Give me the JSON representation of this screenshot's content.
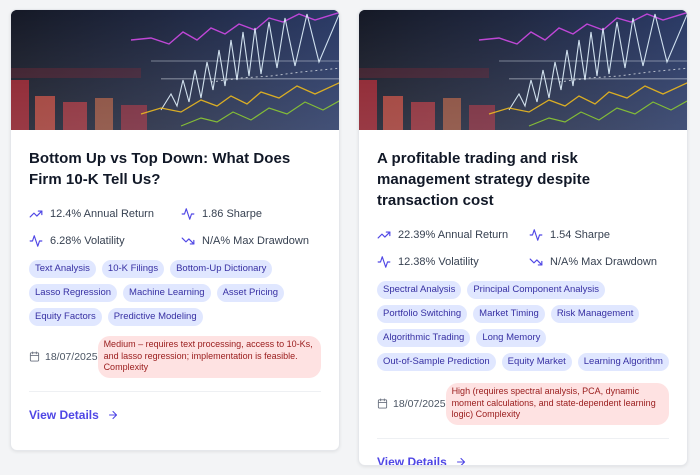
{
  "cards": [
    {
      "title": "Bottom Up vs Top Down: What Does Firm 10-K Tell Us?",
      "metrics": {
        "annual_return": "12.4% Annual Return",
        "sharpe": "1.86 Sharpe",
        "volatility": "6.28% Volatility",
        "max_drawdown": "N/A% Max Drawdown"
      },
      "tags": [
        "Text Analysis",
        "10-K Filings",
        "Bottom-Up Dictionary",
        "Lasso Regression",
        "Machine Learning",
        "Asset Pricing",
        "Equity Factors",
        "Predictive Modeling"
      ],
      "date": "18/07/2025",
      "complexity": "Medium – requires text processing, access to 10-Ks, and lasso regression; implementation is feasible. Complexity",
      "link_label": "View Details"
    },
    {
      "title": "A profitable trading and risk management strategy despite transaction cost",
      "metrics": {
        "annual_return": "22.39% Annual Return",
        "sharpe": "1.54 Sharpe",
        "volatility": "12.38% Volatility",
        "max_drawdown": "N/A% Max Drawdown"
      },
      "tags": [
        "Spectral Analysis",
        "Principal Component Analysis",
        "Portfolio Switching",
        "Market Timing",
        "Risk Management",
        "Algorithmic Trading",
        "Long Memory",
        "Out-of-Sample Prediction",
        "Equity Market",
        "Learning Algorithm"
      ],
      "date": "18/07/2025",
      "complexity": "High (requires spectral analysis, PCA, dynamic moment calculations, and state-dependent learning logic) Complexity",
      "link_label": "View Details"
    }
  ],
  "colors": {
    "accent": "#4f46e5",
    "tag_bg": "#e0e7ff",
    "tag_text": "#3730a3",
    "badge_bg": "#fee2e2",
    "badge_text": "#991b1b"
  },
  "icons": {
    "annual_return": "trending-up-icon",
    "sharpe": "activity-icon",
    "volatility": "activity-icon",
    "max_drawdown": "trending-down-icon",
    "date": "calendar-icon",
    "link": "arrow-right-icon"
  }
}
